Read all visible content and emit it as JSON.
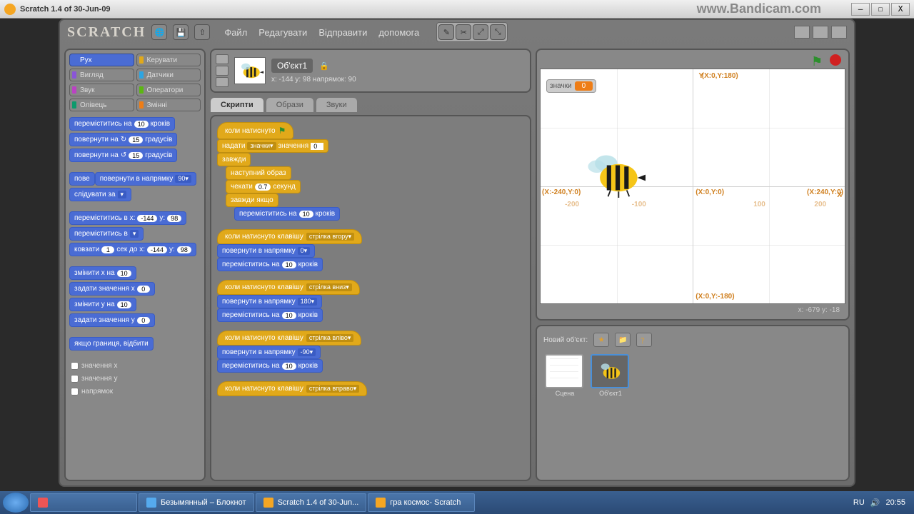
{
  "window": {
    "title": "Scratch 1.4 of 30-Jun-09",
    "watermark": "www.Bandicam.com",
    "min": "—",
    "max": "☐",
    "close": "X"
  },
  "app": {
    "logo": "SCRATCH",
    "menu": [
      "Файл",
      "Редагувати",
      "Відправити",
      "допомога"
    ]
  },
  "categories": [
    {
      "name": "Рух",
      "cls": "cat-motion active"
    },
    {
      "name": "Керувати",
      "cls": "cat-control"
    },
    {
      "name": "Вигляд",
      "cls": "cat-looks"
    },
    {
      "name": "Датчики",
      "cls": "cat-sensing"
    },
    {
      "name": "Звук",
      "cls": "cat-sound"
    },
    {
      "name": "Оператори",
      "cls": "cat-operators"
    },
    {
      "name": "Олівець",
      "cls": "cat-pen"
    },
    {
      "name": "Змінні",
      "cls": "cat-vars"
    }
  ],
  "palette": {
    "move_steps_a": "переміститись на",
    "move_steps_b": "кроків",
    "move_steps_v": "10",
    "turn_cw_a": "повернути на",
    "turn_cw_b": "градусів",
    "turn_cw_v": "15",
    "turn_ccw_a": "повернути на",
    "turn_ccw_b": "градусів",
    "turn_ccw_v": "15",
    "point_dir_a": "повернути в напрямку",
    "point_dir_v": "90▾",
    "point_dir_trunc": "пове",
    "point_to_a": "слідувати за",
    "point_to_v": "▾",
    "goto_xy_a": "переміститись в x:",
    "goto_xy_b": "y:",
    "goto_x": "-144",
    "goto_y": "98",
    "goto_a": "переміститись в",
    "goto_v": "▾",
    "glide_a": "ковзати",
    "glide_b": "сек до x:",
    "glide_c": "y:",
    "glide_s": "1",
    "glide_x": "-144",
    "glide_y": "98",
    "change_x_a": "змінити x на",
    "change_x_v": "10",
    "set_x_a": "задати значення x",
    "set_x_v": "0",
    "change_y_a": "змінити y на",
    "change_y_v": "10",
    "set_y_a": "задати значення y",
    "set_y_v": "0",
    "bounce": "якщо границя, відбити",
    "rep_x": "значення x",
    "rep_y": "значення y",
    "rep_dir": "напрямок"
  },
  "sprite": {
    "name": "Об'єкт1",
    "coords": "x: -144 y: 98    напрямок: 90",
    "tabs": [
      "Скрипти",
      "Образи",
      "Звуки"
    ]
  },
  "scripts": {
    "s1_hat": "коли натиснуто",
    "s1_setvar_a": "надати",
    "s1_setvar_var": "значки▾",
    "s1_setvar_b": "значення",
    "s1_setvar_v": "0",
    "s1_forever": "завжди",
    "s1_next": "наступний образ",
    "s1_wait_a": "чекати",
    "s1_wait_v": "0.7",
    "s1_wait_b": "секунд",
    "s1_forever_if": "завжди якщо",
    "s1_move_a": "переміститись на",
    "s1_move_v": "10",
    "s1_move_b": "кроків",
    "s2_hat": "коли натиснуто клавішу",
    "s2_key": "стрілка вгору▾",
    "s2_point_a": "повернути в напрямку",
    "s2_point_v": "0▾",
    "s2_move_a": "переміститись на",
    "s2_move_v": "10",
    "s2_move_b": "кроків",
    "s3_hat": "коли натиснуто клавішу",
    "s3_key": "стрілка вниз▾",
    "s3_point_a": "повернути в напрямку",
    "s3_point_v": "180▾",
    "s3_move_a": "переміститись на",
    "s3_move_v": "10",
    "s3_move_b": "кроків",
    "s4_hat": "коли натиснуто клавішу",
    "s4_key": "стрілка вліво▾",
    "s4_point_a": "повернути в напрямку",
    "s4_point_v": "-90▾",
    "s4_move_a": "переміститись на",
    "s4_move_v": "10",
    "s4_move_b": "кроків",
    "s5_hat": "коли натиснуто клавішу",
    "s5_key": "стрілка вправо▾"
  },
  "stage": {
    "var_name": "значки",
    "var_val": "0",
    "lbl_top": "(X:0,Y:180)",
    "lbl_left": "(X:-240,Y:0)",
    "lbl_center": "(X:0,Y:0)",
    "lbl_right": "(X:240,Y:0)",
    "lbl_bottom": "(X:0,Y:-180)",
    "axis_y": "Y",
    "axis_x": "X",
    "tick_n200": "-200",
    "tick_n100": "-100",
    "tick_100": "100",
    "tick_200": "200",
    "readout": "x: -679   y: -18"
  },
  "sprites": {
    "new_label": "Новий об'єкт:",
    "tile1": "Об'єкт1",
    "tile_stage": "Сцена"
  },
  "taskbar": {
    "items": [
      "Безымянный – Блокнот",
      "Scratch 1.4 of 30-Jun...",
      "гра космос- Scratch"
    ],
    "lang": "RU",
    "time": "20:55"
  }
}
